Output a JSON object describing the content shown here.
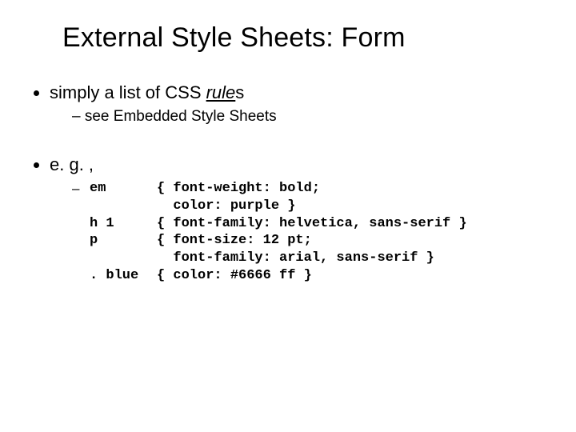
{
  "title": "External Style Sheets: Form",
  "bullet1_prefix": "simply a list of CSS ",
  "bullet1_rule_italic": "rule",
  "bullet1_rule_rest": "s",
  "subbullet1": "see Embedded Style Sheets",
  "bullet2": "e. g. ,",
  "code": {
    "dash": "–",
    "rows": [
      {
        "sel": "em",
        "decl": "{ font-weight: bold;"
      },
      {
        "sel": "",
        "decl": "  color: purple }"
      },
      {
        "sel": "h 1",
        "decl": "{ font-family: helvetica, sans-serif }"
      },
      {
        "sel": "p",
        "decl": "{ font-size: 12 pt;"
      },
      {
        "sel": "",
        "decl": "  font-family: arial, sans-serif }"
      },
      {
        "sel": ". blue",
        "decl": "{ color: #6666 ff }"
      }
    ]
  }
}
